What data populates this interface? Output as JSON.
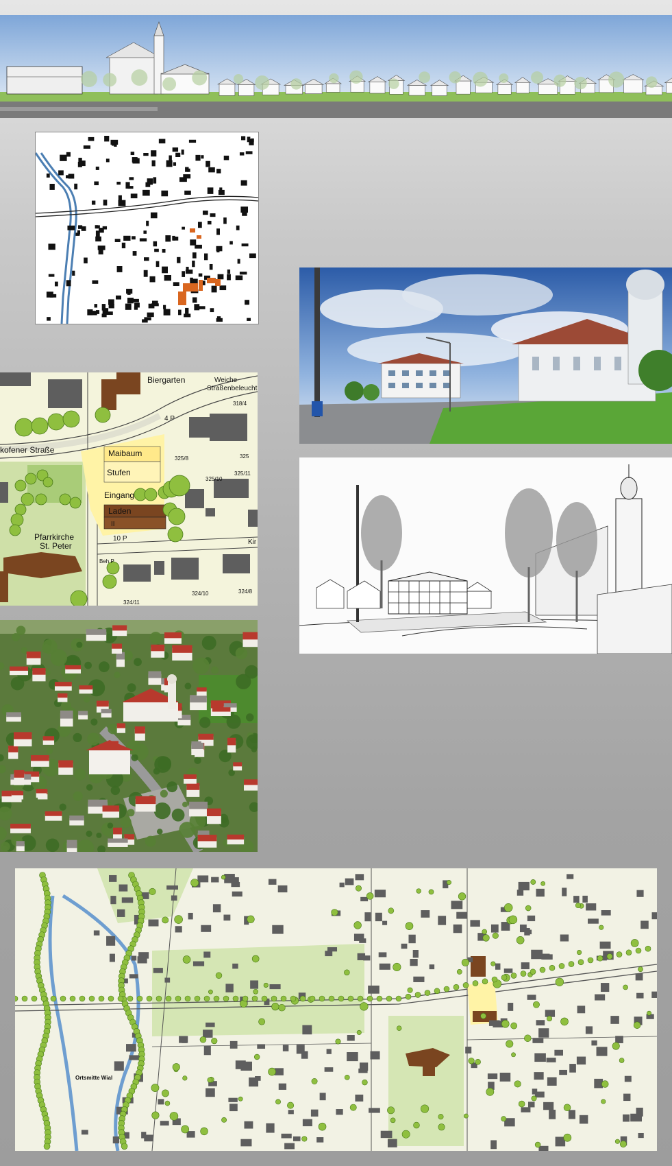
{
  "site_plan": {
    "labels": {
      "biergarten": "Biergarten",
      "street": "kofener Straße",
      "maibaum": "Maibaum",
      "stufen": "Stufen",
      "eingang": "Eingang",
      "laden": "Laden",
      "ii": "II",
      "parking_top": "4 P",
      "parking_bottom": "10 P",
      "church": "Pfarrkirche",
      "church_name": "St. Peter",
      "lighting_1": "Weiche",
      "lighting_2": "Straßenbeleuchtung",
      "kir": "Kir",
      "beh": "Beh P"
    },
    "parcels": [
      "318/4",
      "325",
      "325/8",
      "325/10",
      "325/11",
      "324/10",
      "324/8",
      "324/11"
    ]
  },
  "masterplan": {
    "heading": "Ortsmitte Wial"
  },
  "colors": {
    "building_black": "#111111",
    "building_highlight": "#d9661f",
    "map_bg": "#f2f2e4",
    "green_area": "#cfe0a8",
    "tree_green": "#8fbf3f",
    "building_brown": "#7a4520",
    "building_grey": "#5e5e5e",
    "sky_blue": "#4a7fc8"
  }
}
